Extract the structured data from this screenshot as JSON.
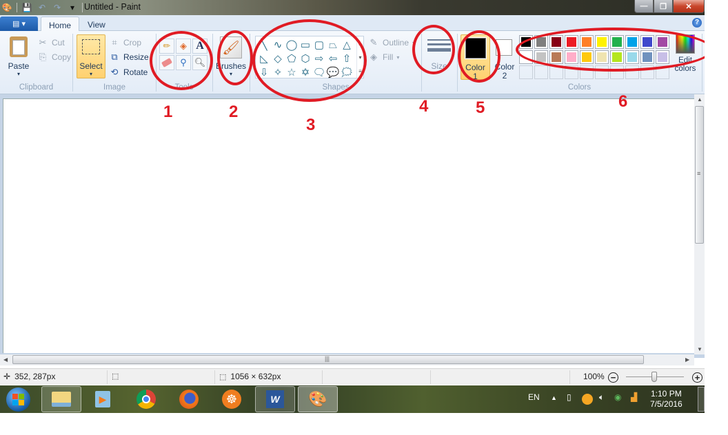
{
  "window": {
    "title": "Untitled - Paint",
    "controls": {
      "minimize": "—",
      "restore": "❐",
      "close": "✕"
    }
  },
  "quick_access": {
    "icons": [
      "paint-app-icon",
      "save-icon",
      "undo-icon",
      "redo-icon",
      "customize-dropdown-icon"
    ]
  },
  "tabs": {
    "app_menu": "▤ ▾",
    "home": "Home",
    "view": "View",
    "help": "?"
  },
  "ribbon": {
    "clipboard": {
      "label": "Clipboard",
      "paste": "Paste",
      "cut": "Cut",
      "copy": "Copy"
    },
    "image": {
      "label": "Image",
      "select": "Select",
      "crop": "Crop",
      "resize": "Resize",
      "rotate": "Rotate"
    },
    "tools": {
      "label": "Tools",
      "items": [
        "pencil",
        "fill",
        "text",
        "eraser",
        "color-picker",
        "magnifier"
      ]
    },
    "brushes": {
      "label": "Brushes"
    },
    "shapes": {
      "label": "Shapes",
      "items": [
        "╲",
        "∿",
        "◯",
        "▭",
        "▢",
        "⏢",
        "△",
        "◺",
        "◇",
        "⬠",
        "⬡",
        "⇨",
        "⇦",
        "⇧",
        "⇩",
        "✧",
        "☆",
        "✡",
        "🗨",
        "💬",
        "🗯"
      ],
      "outline": "Outline",
      "fill": "Fill"
    },
    "size": {
      "label": "Size"
    },
    "color1": {
      "label": "Color",
      "number": "1",
      "value": "#000000"
    },
    "color2": {
      "label": "Color",
      "number": "2",
      "value": "#ffffff"
    },
    "colors": {
      "label": "Colors",
      "row1": [
        "#000000",
        "#7f7f7f",
        "#880015",
        "#ed1c24",
        "#ff7f27",
        "#fff200",
        "#22b14c",
        "#00a2e8",
        "#3f48cc",
        "#a349a4"
      ],
      "row2": [
        "#ffffff",
        "#c3c3c3",
        "#b97a57",
        "#ffaec9",
        "#ffc90e",
        "#efe4b0",
        "#b5e61d",
        "#99d9ea",
        "#7092be",
        "#c8bfe7"
      ],
      "row3_empty_count": 10,
      "edit_colors": "Edit colors"
    }
  },
  "annotations": {
    "labels": [
      "1",
      "2",
      "3",
      "4",
      "5",
      "6"
    ],
    "color": "#e01b24"
  },
  "statusbar": {
    "cursor_position": "352, 287px",
    "selection_size": "",
    "image_size": "1056 × 632px",
    "zoom": "100%",
    "zoom_out": "−",
    "zoom_in": "+"
  },
  "taskbar": {
    "apps": [
      "windows-explorer",
      "media-player",
      "chrome",
      "firefox",
      "helm-app",
      "word",
      "paint"
    ],
    "language": "EN",
    "time": "1:10 PM",
    "date": "7/5/2016"
  }
}
